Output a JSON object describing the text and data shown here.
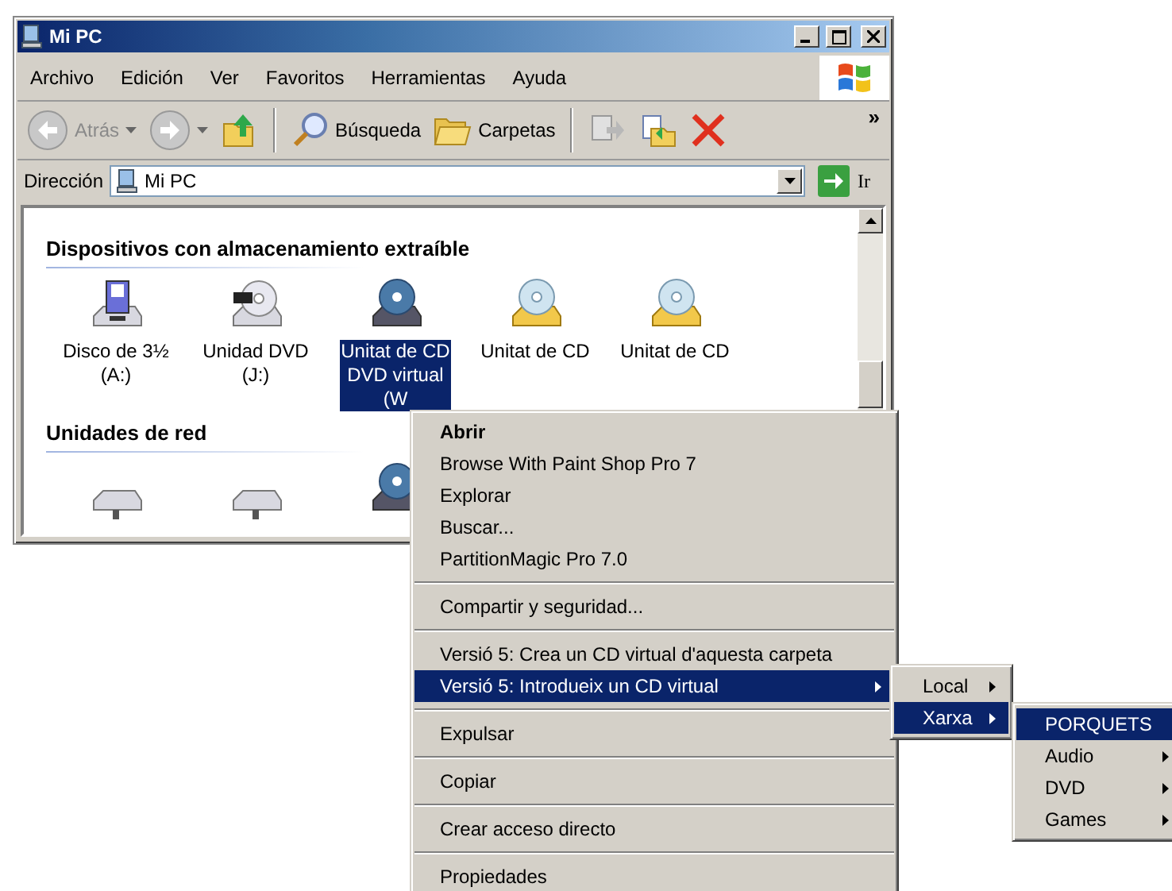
{
  "window": {
    "title": "Mi PC"
  },
  "menu_bar": [
    "Archivo",
    "Edición",
    "Ver",
    "Favoritos",
    "Herramientas",
    "Ayuda"
  ],
  "toolbar": [
    {
      "kind": "back",
      "label": "Atrás",
      "disabled": true
    },
    {
      "kind": "forward",
      "disabled": true
    },
    {
      "kind": "up"
    },
    {
      "kind": "separator"
    },
    {
      "kind": "search",
      "label": "Búsqueda"
    },
    {
      "kind": "folders",
      "label": "Carpetas"
    },
    {
      "kind": "separator"
    },
    {
      "kind": "move",
      "disabled": true
    },
    {
      "kind": "copy"
    },
    {
      "kind": "delete"
    }
  ],
  "toolbar_more": "»",
  "address": {
    "label": "Dirección",
    "value": "Mi PC",
    "go": "Ir"
  },
  "groups": [
    {
      "title": "Dispositivos con almacenamiento extraíble",
      "items": [
        {
          "kind": "floppy",
          "lines": [
            "Disco de 3½",
            "(A:)"
          ],
          "selected": false
        },
        {
          "kind": "dvd",
          "lines": [
            "Unidad DVD",
            "(J:)"
          ],
          "selected": false
        },
        {
          "kind": "cd",
          "lines": [
            "Unitat de CD",
            "DVD virtual",
            "(W"
          ],
          "selected": true
        },
        {
          "kind": "virtual",
          "lines": [
            "Unitat de CD"
          ],
          "selected": false
        },
        {
          "kind": "virtual",
          "lines": [
            "Unitat de CD"
          ],
          "selected": false
        }
      ]
    },
    {
      "title": "Unidades de red",
      "items": [
        {
          "kind": "network"
        },
        {
          "kind": "network"
        },
        {
          "kind": "cd"
        }
      ]
    }
  ],
  "context_menu": [
    [
      {
        "label": "Abrir",
        "default": true,
        "selected": false
      },
      {
        "label": "Browse With Paint Shop Pro 7",
        "selected": false
      },
      {
        "label": "Explorar",
        "selected": false
      },
      {
        "label": "Buscar...",
        "selected": false
      },
      {
        "label": "PartitionMagic Pro 7.0",
        "selected": false
      }
    ],
    [
      {
        "label": "Compartir y seguridad...",
        "selected": false
      }
    ],
    [
      {
        "label": "Versió 5: Crea un CD virtual d'aquesta carpeta",
        "selected": false
      },
      {
        "label": "Versió 5: Introdueix un CD virtual",
        "selected": true,
        "submenu": true
      }
    ],
    [
      {
        "label": "Expulsar",
        "selected": false
      }
    ],
    [
      {
        "label": "Copiar",
        "selected": false
      }
    ],
    [
      {
        "label": "Crear acceso directo",
        "selected": false
      }
    ],
    [
      {
        "label": "Propiedades",
        "selected": false
      }
    ]
  ],
  "submenu": [
    {
      "label": "Local",
      "selected": false,
      "submenu": true
    },
    {
      "label": "Xarxa",
      "selected": true,
      "submenu": true
    }
  ],
  "submenu_2": [
    {
      "label": "PORQUETS",
      "selected": true,
      "submenu": false
    },
    {
      "label": "Audio",
      "selected": false,
      "submenu": true
    },
    {
      "label": "DVD",
      "selected": false,
      "submenu": true
    },
    {
      "label": "Games",
      "selected": false,
      "submenu": true
    }
  ]
}
